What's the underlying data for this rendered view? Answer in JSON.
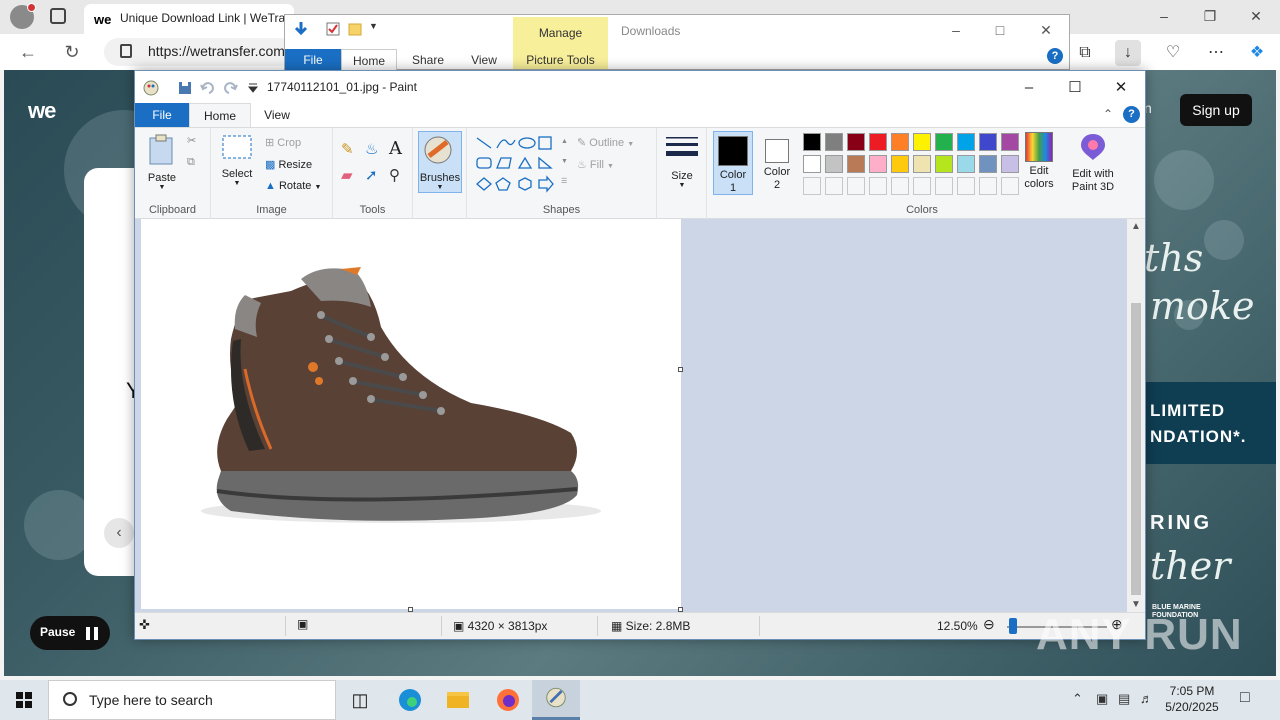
{
  "browser": {
    "tab_title": "Unique Download Link | WeTransfer",
    "tab_favicon": "we",
    "url": "https://wetransfer.com",
    "colors": {
      "frame": "#e8e8e8",
      "download_active": "#e1e1e1"
    }
  },
  "site": {
    "logo": "we",
    "login_fragment": "n",
    "signup": "Sign up",
    "partial_letter": "Y",
    "pause": "Pause",
    "ad_script_1": "ths",
    "ad_script_2": "moke",
    "ad_band_1": "LIMITED",
    "ad_band_2": "NDATION*.",
    "ad_ring": "RING",
    "ad_script_3": "ther",
    "ad_org_1": "BLUE MARINE",
    "ad_org_2": "FOUNDATION"
  },
  "explorer": {
    "title": "Downloads",
    "manage": "Manage",
    "tabs": {
      "file": "File",
      "home": "Home",
      "share": "Share",
      "view": "View",
      "picture_tools": "Picture Tools"
    },
    "help": "?"
  },
  "paint": {
    "title": "17740112101_01.jpg - Paint",
    "tabs": {
      "file": "File",
      "home": "Home",
      "view": "View"
    },
    "help": "?",
    "clipboard": {
      "paste": "Paste",
      "label": "Clipboard"
    },
    "image": {
      "select": "Select",
      "crop": "Crop",
      "resize": "Resize",
      "rotate": "Rotate",
      "label": "Image"
    },
    "tools": {
      "label": "Tools",
      "text_glyph": "A"
    },
    "brushes": "Brushes",
    "shapes": {
      "outline": "Outline",
      "fill": "Fill",
      "label": "Shapes"
    },
    "size": "Size",
    "color1": "Color 1",
    "color2": "Color 2",
    "colors_label": "Colors",
    "edit_colors": "Edit colors",
    "edit_3d": "Edit with Paint 3D",
    "palette_row1": [
      "#000000",
      "#7f7f7f",
      "#880015",
      "#ed1c24",
      "#ff7f27",
      "#fff200",
      "#22b14c",
      "#00a2e8",
      "#3f48cc",
      "#a349a4"
    ],
    "palette_row2": [
      "#ffffff",
      "#c3c3c3",
      "#b97a57",
      "#ffaec9",
      "#ffc90e",
      "#efe4b0",
      "#b5e61d",
      "#99d9ea",
      "#7092be",
      "#c8bfe7"
    ],
    "palette_row3_count_hint": "empty custom slots",
    "status": {
      "dimensions": "4320 × 3813px",
      "size": "Size: 2.8MB",
      "zoom": "12.50%",
      "zoom_fraction": 0.125
    },
    "accent": "#1a6fc4"
  },
  "taskbar": {
    "search_placeholder": "Type here to search",
    "time": "7:05 PM",
    "date": "5/20/2025"
  },
  "watermark": "ANY RUN"
}
